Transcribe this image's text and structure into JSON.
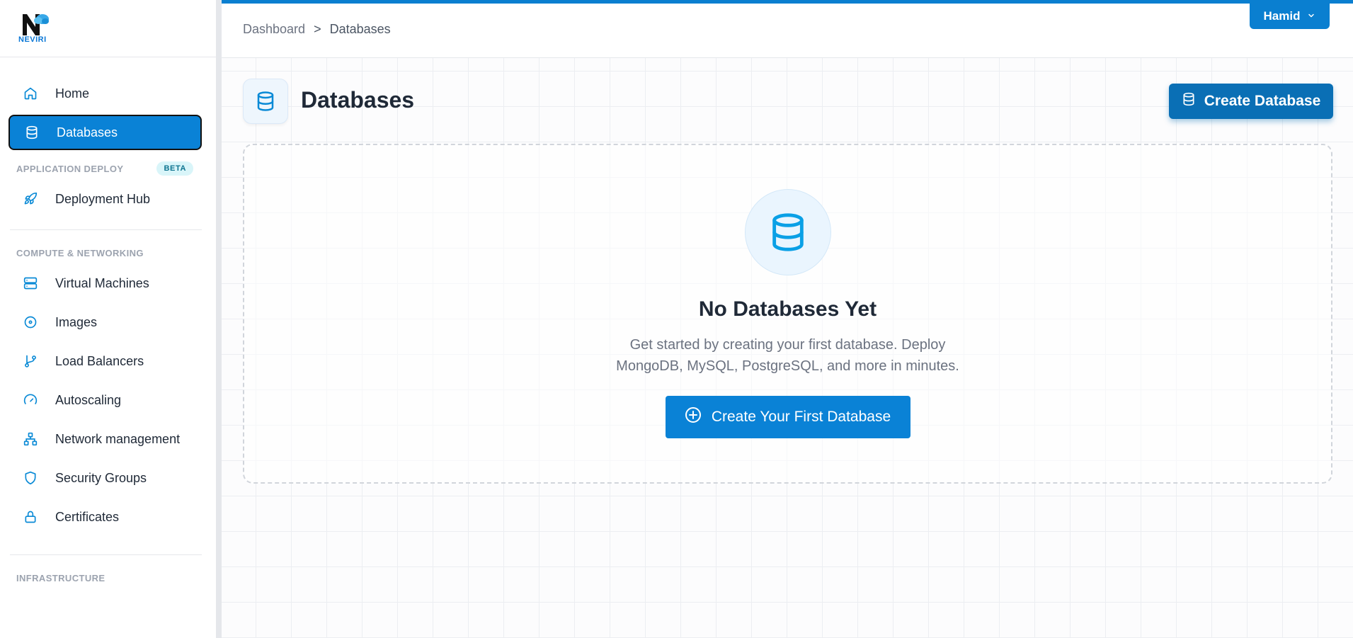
{
  "brand": {
    "name": "NEVIRI",
    "accent": "#0a82d6"
  },
  "sidebar": {
    "top_items": [
      {
        "label": "Home",
        "icon": "home-icon"
      },
      {
        "label": "Databases",
        "icon": "database-icon",
        "active": true
      }
    ],
    "sections": [
      {
        "title": "APPLICATION DEPLOY",
        "badge": "BETA",
        "items": [
          {
            "label": "Deployment Hub",
            "icon": "rocket-icon"
          }
        ]
      },
      {
        "title": "COMPUTE & NETWORKING",
        "items": [
          {
            "label": "Virtual Machines",
            "icon": "server-icon"
          },
          {
            "label": "Images",
            "icon": "disc-icon"
          },
          {
            "label": "Load Balancers",
            "icon": "git-branch-icon"
          },
          {
            "label": "Autoscaling",
            "icon": "gauge-icon"
          },
          {
            "label": "Network management",
            "icon": "network-icon"
          },
          {
            "label": "Security Groups",
            "icon": "shield-icon"
          },
          {
            "label": "Certificates",
            "icon": "lock-icon"
          }
        ]
      },
      {
        "title": "INFRASTRUCTURE",
        "items": []
      }
    ]
  },
  "topbar": {
    "breadcrumb": [
      "Dashboard",
      ">",
      "Databases"
    ],
    "user": "Hamid"
  },
  "main": {
    "title": "Databases",
    "create_button": "Create Database",
    "empty_state": {
      "title": "No Databases Yet",
      "description": "Get started by creating your first database. Deploy MongoDB, MySQL, PostgreSQL, and more in minutes.",
      "button": "Create Your First Database"
    }
  }
}
